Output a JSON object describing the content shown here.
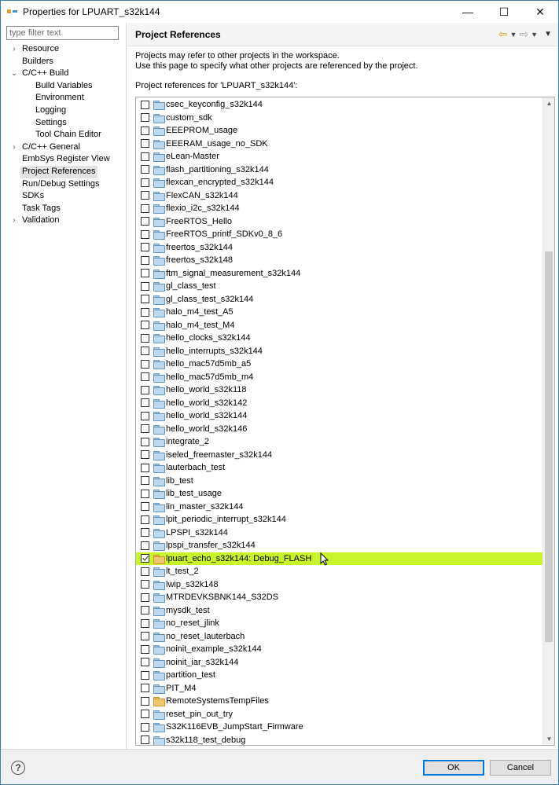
{
  "window": {
    "title": "Properties for LPUART_s32k144",
    "minimize": "—",
    "maximize": "☐",
    "close": "✕"
  },
  "filter": {
    "placeholder": "type filter text",
    "value": ""
  },
  "tree": [
    {
      "label": "Resource",
      "depth": 0,
      "twisty": "›"
    },
    {
      "label": "Builders",
      "depth": 0,
      "twisty": ""
    },
    {
      "label": "C/C++ Build",
      "depth": 0,
      "twisty": "⌄"
    },
    {
      "label": "Build Variables",
      "depth": 1,
      "twisty": ""
    },
    {
      "label": "Environment",
      "depth": 1,
      "twisty": ""
    },
    {
      "label": "Logging",
      "depth": 1,
      "twisty": ""
    },
    {
      "label": "Settings",
      "depth": 1,
      "twisty": ""
    },
    {
      "label": "Tool Chain Editor",
      "depth": 1,
      "twisty": ""
    },
    {
      "label": "C/C++ General",
      "depth": 0,
      "twisty": "›"
    },
    {
      "label": "EmbSys Register View",
      "depth": 0,
      "twisty": ""
    },
    {
      "label": "Project References",
      "depth": 0,
      "twisty": "",
      "selected": true
    },
    {
      "label": "Run/Debug Settings",
      "depth": 0,
      "twisty": ""
    },
    {
      "label": "SDKs",
      "depth": 0,
      "twisty": ""
    },
    {
      "label": "Task Tags",
      "depth": 0,
      "twisty": ""
    },
    {
      "label": "Validation",
      "depth": 0,
      "twisty": "›"
    }
  ],
  "page": {
    "title": "Project References",
    "desc_line1": "Projects may refer to other projects in the workspace.",
    "desc_line2": "Use this page to specify what other projects are referenced by the project.",
    "refs_label": "Project references for 'LPUART_s32k144':"
  },
  "projects": [
    {
      "name": "csec_keyconfig_s32k144",
      "checked": false
    },
    {
      "name": "custom_sdk",
      "checked": false
    },
    {
      "name": "EEEPROM_usage",
      "checked": false
    },
    {
      "name": "EEERAM_usage_no_SDK",
      "checked": false
    },
    {
      "name": "eLean-Master",
      "checked": false
    },
    {
      "name": "flash_partitioning_s32k144",
      "checked": false
    },
    {
      "name": "flexcan_encrypted_s32k144",
      "checked": false
    },
    {
      "name": "FlexCAN_s32k144",
      "checked": false
    },
    {
      "name": "flexio_i2c_s32k144",
      "checked": false
    },
    {
      "name": "FreeRTOS_Hello",
      "checked": false
    },
    {
      "name": "FreeRTOS_printf_SDKv0_8_6",
      "checked": false
    },
    {
      "name": "freertos_s32k144",
      "checked": false
    },
    {
      "name": "freertos_s32k148",
      "checked": false
    },
    {
      "name": "ftm_signal_measurement_s32k144",
      "checked": false
    },
    {
      "name": "gl_class_test",
      "checked": false
    },
    {
      "name": "gl_class_test_s32k144",
      "checked": false
    },
    {
      "name": "halo_m4_test_A5",
      "checked": false
    },
    {
      "name": "halo_m4_test_M4",
      "checked": false
    },
    {
      "name": "hello_clocks_s32k144",
      "checked": false
    },
    {
      "name": "hello_interrupts_s32k144",
      "checked": false
    },
    {
      "name": "hello_mac57d5mb_a5",
      "checked": false
    },
    {
      "name": "hello_mac57d5mb_m4",
      "checked": false
    },
    {
      "name": "hello_world_s32k118",
      "checked": false
    },
    {
      "name": "hello_world_s32k142",
      "checked": false
    },
    {
      "name": "hello_world_s32k144",
      "checked": false
    },
    {
      "name": "hello_world_s32k146",
      "checked": false
    },
    {
      "name": "integrate_2",
      "checked": false
    },
    {
      "name": "iseled_freemaster_s32k144",
      "checked": false
    },
    {
      "name": "lauterbach_test",
      "checked": false
    },
    {
      "name": "lib_test",
      "checked": false
    },
    {
      "name": "lib_test_usage",
      "checked": false
    },
    {
      "name": "lin_master_s32k144",
      "checked": false
    },
    {
      "name": "lpit_periodic_interrupt_s32k144",
      "checked": false
    },
    {
      "name": "LPSPI_s32k144",
      "checked": false
    },
    {
      "name": "lpspi_transfer_s32k144",
      "checked": false
    },
    {
      "name": "lpuart_echo_s32k144: Debug_FLASH",
      "checked": true,
      "highlight": true,
      "open": true
    },
    {
      "name": "lt_test_2",
      "checked": false
    },
    {
      "name": "lwip_s32k148",
      "checked": false
    },
    {
      "name": "MTRDEVKSBNK144_S32DS",
      "checked": false
    },
    {
      "name": "mysdk_test",
      "checked": false
    },
    {
      "name": "no_reset_jlink",
      "checked": false
    },
    {
      "name": "no_reset_lauterbach",
      "checked": false
    },
    {
      "name": "noinit_example_s32k144",
      "checked": false
    },
    {
      "name": "noinit_iar_s32k144",
      "checked": false
    },
    {
      "name": "partition_test",
      "checked": false
    },
    {
      "name": "PIT_M4",
      "checked": false
    },
    {
      "name": "RemoteSystemsTempFiles",
      "checked": false,
      "open": true
    },
    {
      "name": "reset_pin_out_try",
      "checked": false
    },
    {
      "name": "S32K116EVB_JumpStart_Firmware",
      "checked": false
    },
    {
      "name": "s32k118_test_debug",
      "checked": false
    }
  ],
  "buttons": {
    "ok": "OK",
    "cancel": "Cancel",
    "help": "?"
  },
  "colors": {
    "highlight": "#c8f529",
    "accent": "#0078d7"
  }
}
